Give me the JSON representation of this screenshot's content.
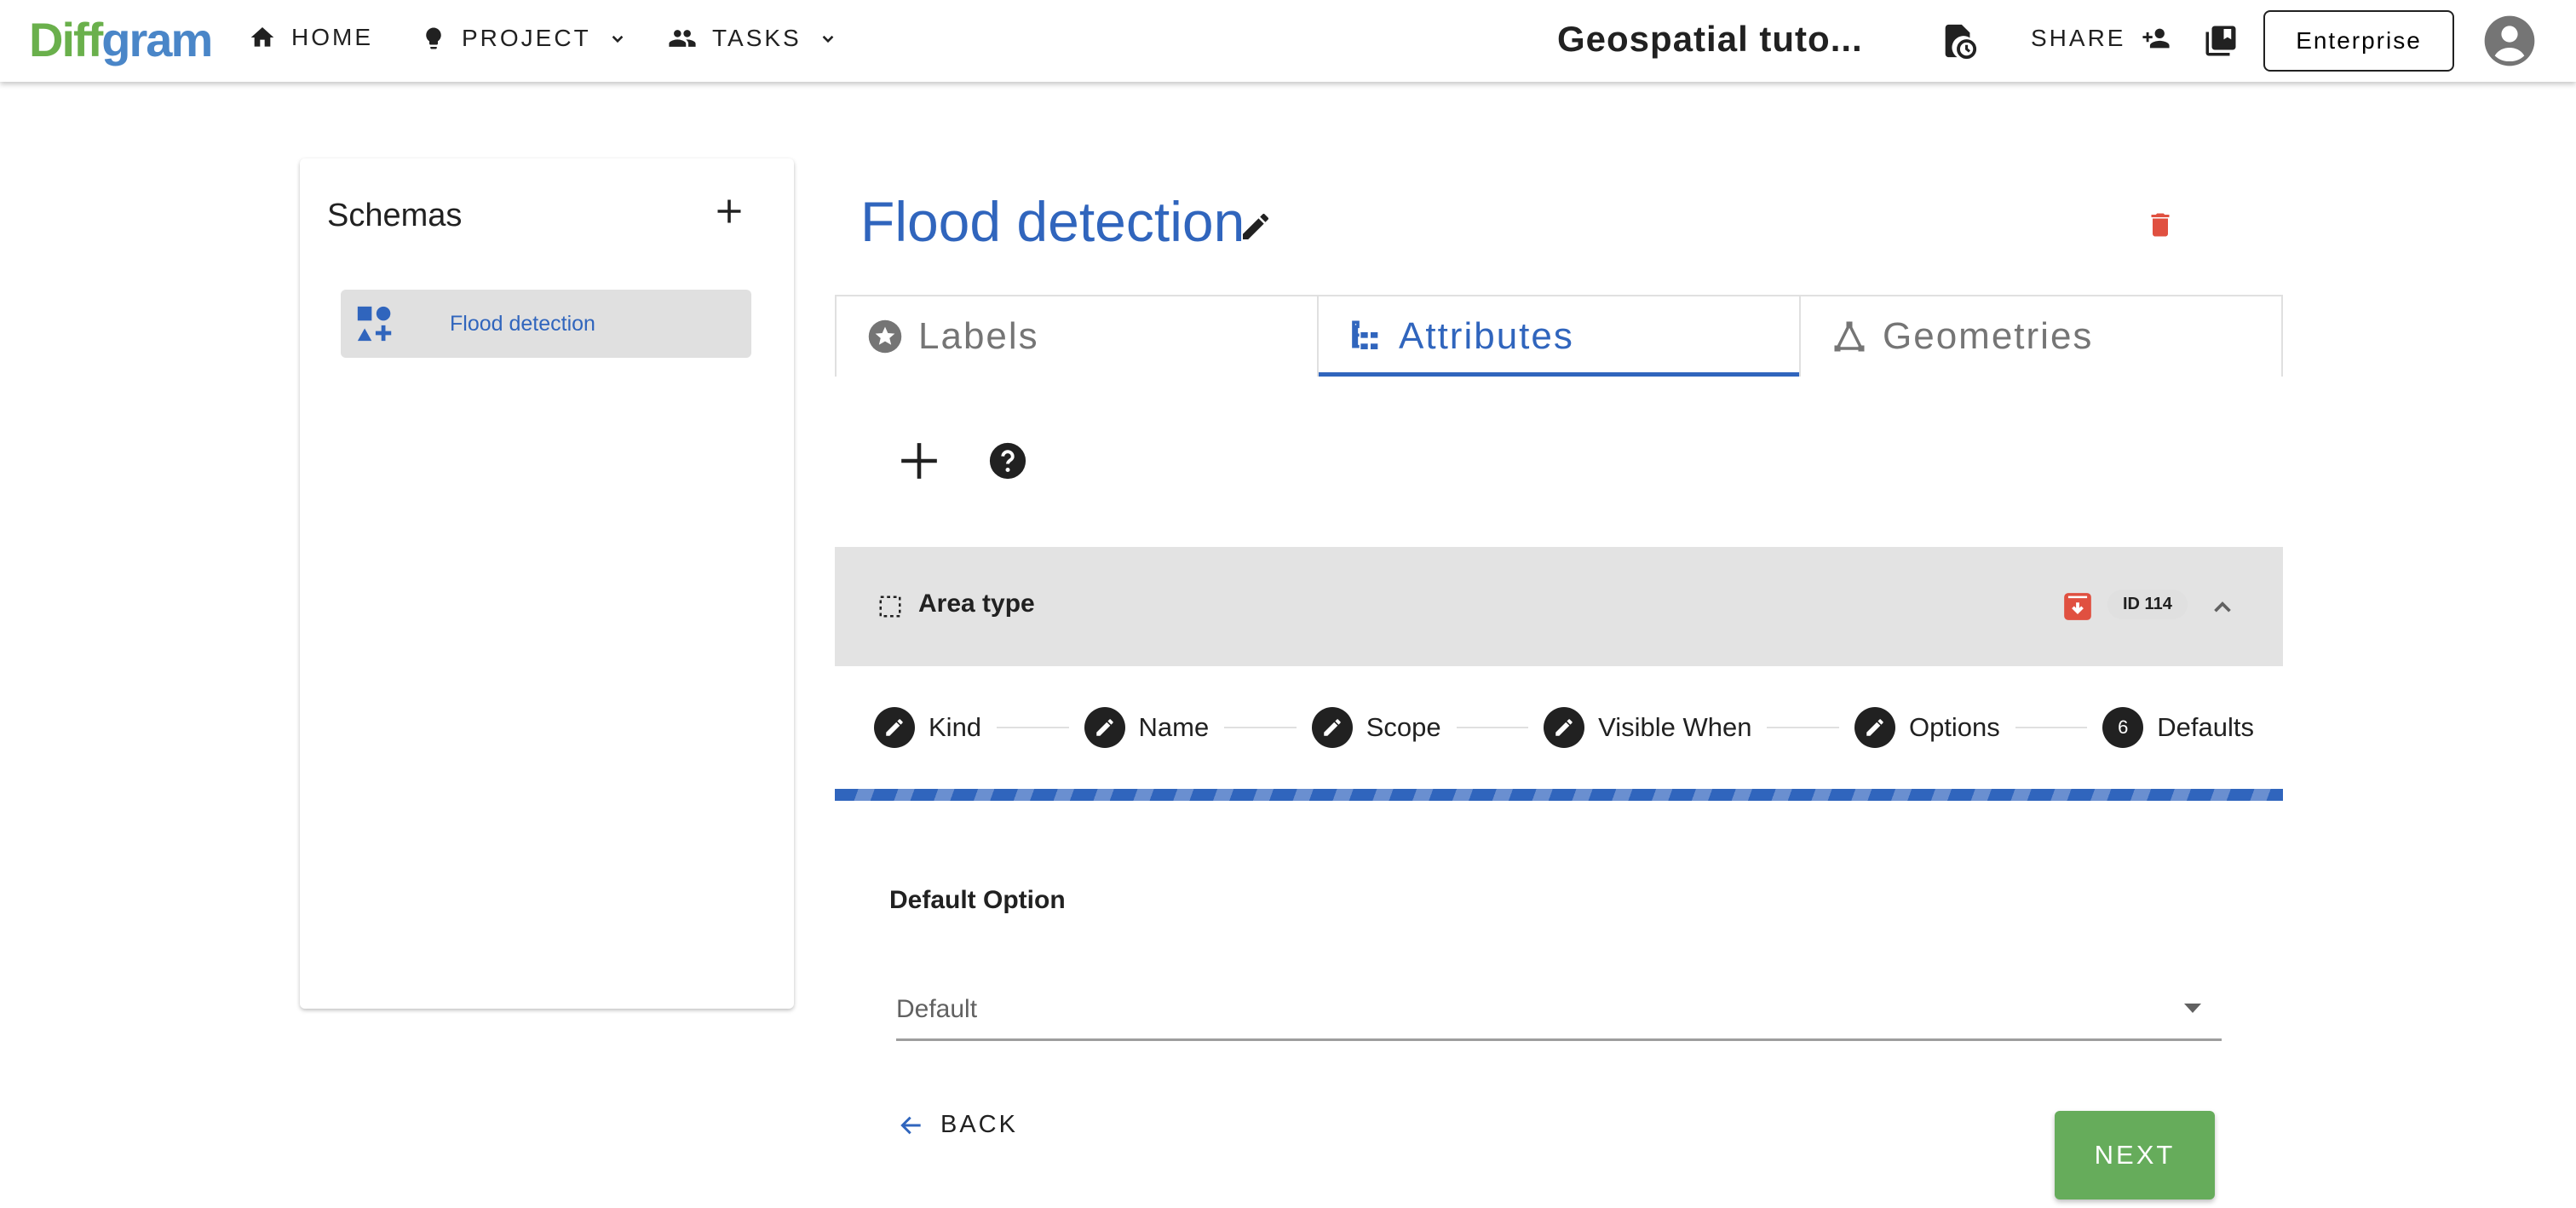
{
  "topbar": {
    "logo_part1": "Diff",
    "logo_part2": "gram",
    "nav": [
      {
        "label": "HOME",
        "icon": "home-icon"
      },
      {
        "label": "PROJECT",
        "icon": "lightbulb-icon"
      },
      {
        "label": "TASKS",
        "icon": "people-icon"
      }
    ],
    "project_title": "Geospatial tuto...",
    "share_label": "SHARE",
    "enterprise_label": "Enterprise"
  },
  "sidebar": {
    "title": "Schemas",
    "items": [
      {
        "label": "Flood detection",
        "icon": "shapes-icon",
        "selected": true
      }
    ]
  },
  "main": {
    "title": "Flood detection",
    "tabs": [
      {
        "label": "Labels",
        "icon": "star-circle-icon",
        "active": false
      },
      {
        "label": "Attributes",
        "icon": "tree-icon",
        "active": true
      },
      {
        "label": "Geometries",
        "icon": "polygon-icon",
        "active": false
      }
    ],
    "attribute": {
      "name": "Area type",
      "id_label": "ID 114"
    },
    "steps": [
      {
        "label": "Kind",
        "state": "edit"
      },
      {
        "label": "Name",
        "state": "edit"
      },
      {
        "label": "Scope",
        "state": "edit"
      },
      {
        "label": "Visible When",
        "state": "edit"
      },
      {
        "label": "Options",
        "state": "edit"
      },
      {
        "label": "Defaults",
        "state": "current",
        "number": "6"
      }
    ],
    "section_title": "Default Option",
    "select_value": "Default",
    "back_label": "BACK",
    "next_label": "NEXT"
  },
  "colors": {
    "primary": "#3065bd",
    "success": "#66ac5b",
    "danger": "#e05040"
  }
}
